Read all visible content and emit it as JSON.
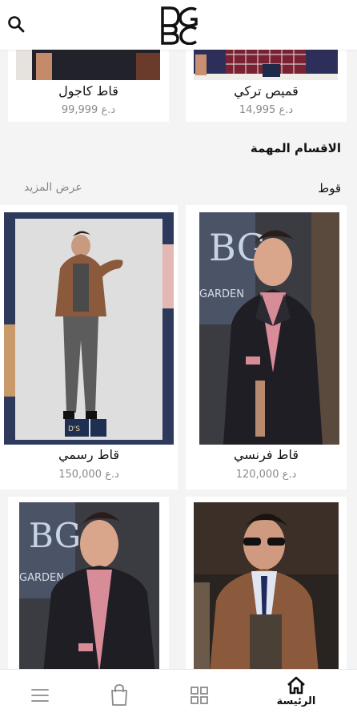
{
  "header": {
    "logo_text": "DG BC",
    "search_icon": "search-icon"
  },
  "top_products": [
    {
      "name": "قميص تركي",
      "price": "14,995 د.ع"
    },
    {
      "name": "قاط كاجول",
      "price": "99,999 د.ع"
    }
  ],
  "section": {
    "title": "الاقسام المهمة",
    "category": "قوط",
    "more_label": "عرض المزيد"
  },
  "products": [
    {
      "name": "قاط  فرنسي",
      "price": "120,000 د.ع"
    },
    {
      "name": "قاط رسمي",
      "price": "150,000 د.ع"
    }
  ],
  "bottom_nav": {
    "home_label": "الرئيسة",
    "icons": [
      "home-icon",
      "grid-icon",
      "shopping-bag-icon",
      "menu-icon"
    ]
  },
  "colors": {
    "brown_jacket": "#8b5a3c",
    "dark_jacket": "#1f1f24",
    "pink_shirt": "#d88c98",
    "navy_frame": "#2e3a5c"
  }
}
